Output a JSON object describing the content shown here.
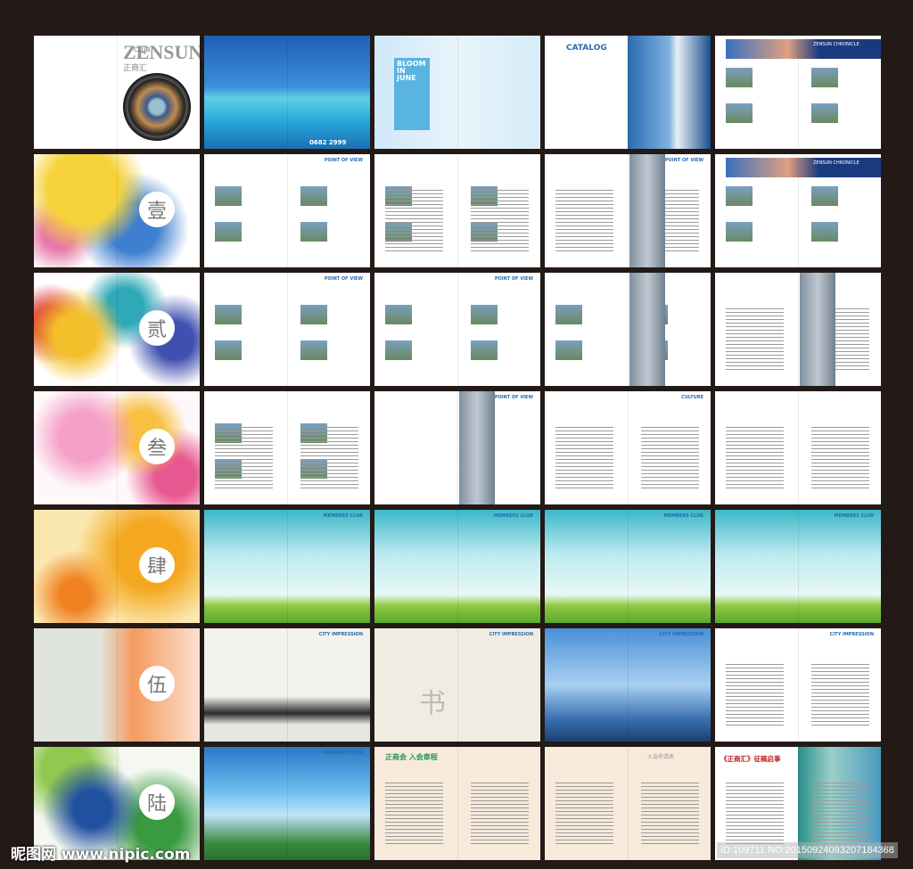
{
  "pages": [
    {
      "theme": "t-cover",
      "texts": [
        {
          "t": "ZENSUN",
          "cls": "zen"
        },
        {
          "t": "CLUB",
          "cls": "club"
        },
        {
          "t": "正商汇",
          "cls": "zsh"
        }
      ],
      "lens": true
    },
    {
      "theme": "t-beach",
      "texts": [
        {
          "t": "0682 2999",
          "cls": "phone"
        }
      ]
    },
    {
      "theme": "t-tree",
      "texts": [
        {
          "t": "BLOOM IN JUNE",
          "cls": "bloom"
        }
      ]
    },
    {
      "theme": "t-catalog",
      "texts": [
        {
          "t": "CATALOG",
          "cls": "catalog"
        }
      ]
    },
    {
      "theme": "t-header",
      "texts": [
        {
          "t": "ZENSUN CHRONICLE",
          "cls": "hdr"
        }
      ],
      "photos": true
    },
    {
      "theme": "t-wc1",
      "chapter": "壹"
    },
    {
      "theme": "t-white",
      "texts": [
        {
          "t": "POINT OF VIEW",
          "cls": "pov"
        }
      ],
      "photos": true
    },
    {
      "theme": "t-white",
      "photos": true,
      "lines": true
    },
    {
      "theme": "t-white",
      "texts": [
        {
          "t": "POINT OF VIEW",
          "cls": "pov"
        }
      ],
      "lines": true,
      "building": true
    },
    {
      "theme": "t-header",
      "texts": [
        {
          "t": "ZENSUN CHRONICLE",
          "cls": "hdr"
        }
      ],
      "photos": true
    },
    {
      "theme": "t-wc2",
      "chapter": "贰"
    },
    {
      "theme": "t-white",
      "texts": [
        {
          "t": "POINT OF VIEW",
          "cls": "pov"
        }
      ],
      "photos": true
    },
    {
      "theme": "t-white",
      "texts": [
        {
          "t": "POINT OF VIEW",
          "cls": "pov"
        }
      ],
      "photos": true
    },
    {
      "theme": "t-white",
      "photos": true,
      "building": true
    },
    {
      "theme": "t-white",
      "lines": true,
      "building": true
    },
    {
      "theme": "t-wc3",
      "chapter": "叁"
    },
    {
      "theme": "t-white",
      "lines": true,
      "photos": true
    },
    {
      "theme": "t-white",
      "texts": [
        {
          "t": "POINT OF VIEW",
          "cls": "pov"
        }
      ],
      "building": true
    },
    {
      "theme": "t-white",
      "texts": [
        {
          "t": "CULTURE",
          "cls": "pov"
        }
      ],
      "lines": true
    },
    {
      "theme": "t-white",
      "lines": true
    },
    {
      "theme": "t-wc4",
      "chapter": "肆"
    },
    {
      "theme": "t-club",
      "texts": [
        {
          "t": "MEMBERS CLUB",
          "cls": "pov"
        }
      ]
    },
    {
      "theme": "t-club",
      "texts": [
        {
          "t": "MEMBERS CLUB",
          "cls": "pov"
        }
      ]
    },
    {
      "theme": "t-club",
      "texts": [
        {
          "t": "MEMBERS CLUB",
          "cls": "pov"
        }
      ]
    },
    {
      "theme": "t-club",
      "texts": [
        {
          "t": "MEMBERS CLUB",
          "cls": "pov"
        }
      ]
    },
    {
      "theme": "t-wc5",
      "chapter": "伍"
    },
    {
      "theme": "t-ink",
      "texts": [
        {
          "t": "CITY IMPRESSION",
          "cls": "pov"
        }
      ]
    },
    {
      "theme": "t-callig",
      "texts": [
        {
          "t": "CITY IMPRESSION",
          "cls": "pov"
        },
        {
          "t": "书",
          "cls": "shu"
        }
      ]
    },
    {
      "theme": "t-city",
      "texts": [
        {
          "t": "CITY IMPRESSION",
          "cls": "pov"
        }
      ]
    },
    {
      "theme": "t-white",
      "texts": [
        {
          "t": "CITY IMPRESSION",
          "cls": "pov"
        }
      ],
      "lines": true
    },
    {
      "theme": "t-wc6",
      "chapter": "陆"
    },
    {
      "theme": "t-soccer",
      "texts": [
        {
          "t": "MEMBERS CLUB",
          "cls": "pov"
        }
      ]
    },
    {
      "theme": "t-beige",
      "texts": [
        {
          "t": "正商会 入会章程",
          "cls": "rule"
        }
      ],
      "lines": true
    },
    {
      "theme": "t-beige",
      "texts": [
        {
          "t": "入会申请表",
          "cls": "form"
        }
      ],
      "lines": true
    },
    {
      "theme": "t-notice",
      "texts": [
        {
          "t": "《正商汇》征稿启事",
          "cls": "notice"
        }
      ],
      "lines": true
    }
  ],
  "watermark": "昵图网 www.nipic.com",
  "image_id": "ID:109711 NO:20150924093207184368"
}
